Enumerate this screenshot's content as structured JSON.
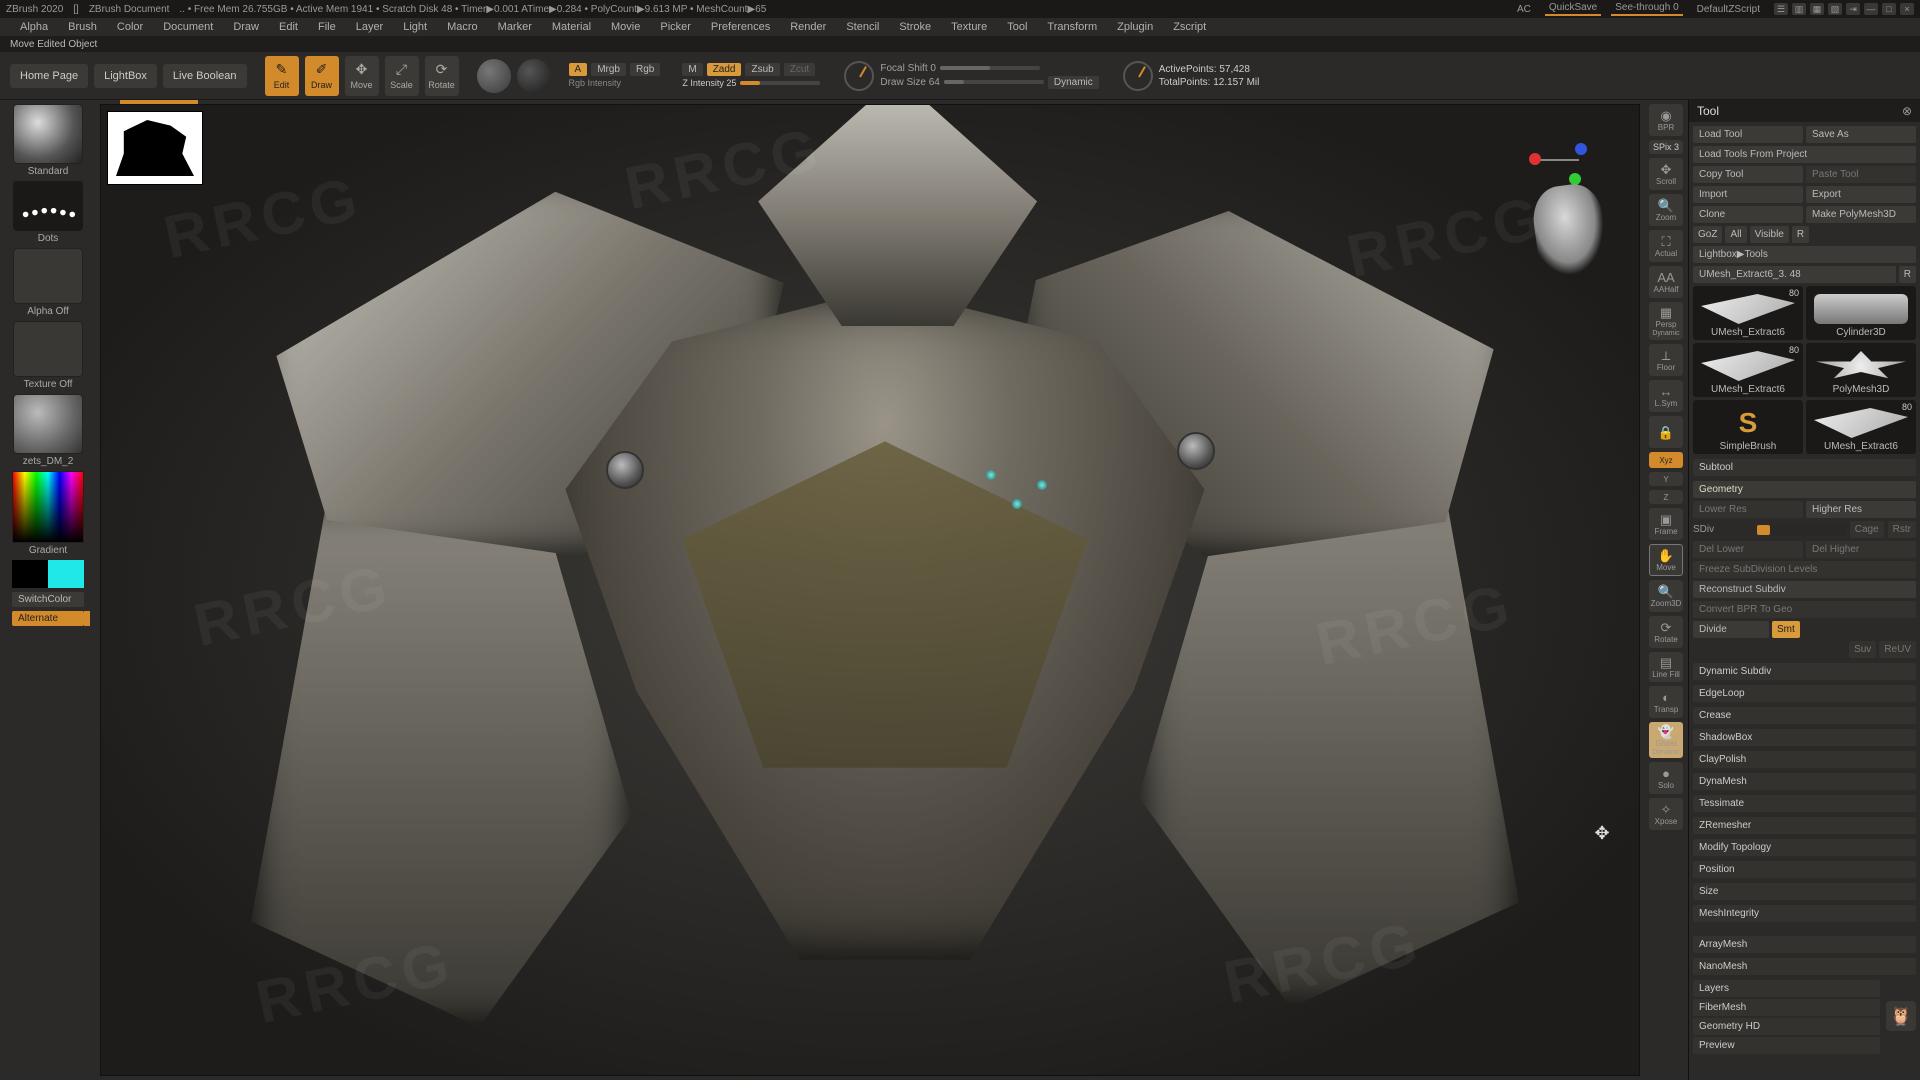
{
  "titlebar": {
    "app": "ZBrush 2020",
    "doc": "ZBrush Document",
    "stats": ".. • Free Mem 26.755GB • Active Mem 1941 • Scratch Disk 48 • Timer▶0.001 ATime▶0.284 • PolyCount▶9.613 MP • MeshCount▶65",
    "ac": "AC",
    "quicksave": "QuickSave",
    "seethrough": "See-through  0",
    "defaultscript": "DefaultZScript"
  },
  "menubar": [
    "Alpha",
    "Brush",
    "Color",
    "Document",
    "Draw",
    "Edit",
    "File",
    "Layer",
    "Light",
    "Macro",
    "Marker",
    "Material",
    "Movie",
    "Picker",
    "Preferences",
    "Render",
    "Stencil",
    "Stroke",
    "Texture",
    "Tool",
    "Transform",
    "Zplugin",
    "Zscript"
  ],
  "statusline": "Move Edited Object",
  "toolbar": {
    "homepage": "Home Page",
    "lightbox": "LightBox",
    "liveboolean": "Live Boolean",
    "edit": "Edit",
    "draw": "Draw",
    "move": "Move",
    "scale": "Scale",
    "rotate": "Rotate",
    "a_label": "A",
    "mrgb": "Mrgb",
    "rgb": "Rgb",
    "rgb_intensity": "Rgb Intensity",
    "m_label": "M",
    "zadd": "Zadd",
    "zsub": "Zsub",
    "zcut": "Zcut",
    "z_intensity": "Z Intensity 25",
    "focal_label": "Focal Shift 0",
    "drawsize_label": "Draw Size  64",
    "dynamic": "Dynamic",
    "activepoints": "ActivePoints: 57,428",
    "totalpoints": "TotalPoints: 12.157 Mil"
  },
  "left": {
    "brush": "Standard",
    "stroke": "Dots",
    "alpha": "Alpha Off",
    "texture": "Texture Off",
    "material": "zets_DM_2",
    "gradient": "Gradient",
    "switchcolor": "SwitchColor",
    "alternate": "Alternate"
  },
  "rightstrip": {
    "bpr": "BPR",
    "spix": "SPix 3",
    "scroll": "Scroll",
    "zoom": "Zoom",
    "actual": "Actual",
    "aahalf": "AAHalf",
    "persp": "Persp",
    "floor": "Floor",
    "lsym": "L.Sym",
    "lock": "🔒",
    "xyz": "Xyz",
    "y": "Y",
    "z": "Z",
    "frame": "Frame",
    "move": "Move",
    "zoom3d": "Zoom3D",
    "rotate": "Rotate",
    "linefill": "Line Fill",
    "transp": "Transp",
    "ghost": "Ghost",
    "solo": "Solo",
    "xpose": "Xpose",
    "dynamic": "Dynamic"
  },
  "tool": {
    "header": "Tool",
    "load": "Load Tool",
    "saveas": "Save As",
    "loadproj": "Load Tools From Project",
    "copy": "Copy Tool",
    "paste": "Paste Tool",
    "import": "Import",
    "export": "Export",
    "clone": "Clone",
    "makepoly": "Make PolyMesh3D",
    "goz": "GoZ",
    "all": "All",
    "visible": "Visible",
    "r1": "R",
    "lightbox_tools": "Lightbox▶Tools",
    "current": "UMesh_Extract6_3. 48",
    "r2": "R",
    "thumbs": [
      {
        "label": "UMesh_Extract6",
        "count": "80",
        "shape": "paper"
      },
      {
        "label": "Cylinder3D",
        "count": "",
        "shape": "cyl"
      },
      {
        "label": "PolyMesh3D",
        "count": "",
        "shape": "star"
      },
      {
        "label": "SimpleBrush",
        "count": "",
        "shape": "s"
      },
      {
        "label": "UMesh_Extract6",
        "count": "80",
        "shape": "paper"
      }
    ],
    "sections": {
      "subtool": "Subtool",
      "geometry": "Geometry",
      "lowerres": "Lower Res",
      "higherres": "Higher Res",
      "sdiv": "SDiv",
      "cage": "Cage",
      "rstr": "Rstr",
      "dellower": "Del Lower",
      "delhigher": "Del Higher",
      "freeze": "Freeze SubDivision Levels",
      "reconstruct": "Reconstruct Subdiv",
      "convertbpr": "Convert BPR To Geo",
      "divide": "Divide",
      "smt": "Smt",
      "suv": "Suv",
      "reuv": "ReUV",
      "dynamic": "Dynamic Subdiv",
      "edgeloop": "EdgeLoop",
      "crease": "Crease",
      "shadowbox": "ShadowBox",
      "claypolish": "ClayPolish",
      "dynamesh": "DynaMesh",
      "tessimate": "Tessimate",
      "zremesher": "ZRemesher",
      "modifytopo": "Modify Topology",
      "position": "Position",
      "size": "Size",
      "meshintegrity": "MeshIntegrity",
      "arraymesh": "ArrayMesh",
      "nanomesh": "NanoMesh",
      "layers": "Layers",
      "fibermesh": "FiberMesh",
      "geometryhd": "Geometry HD",
      "preview": "Preview"
    }
  }
}
